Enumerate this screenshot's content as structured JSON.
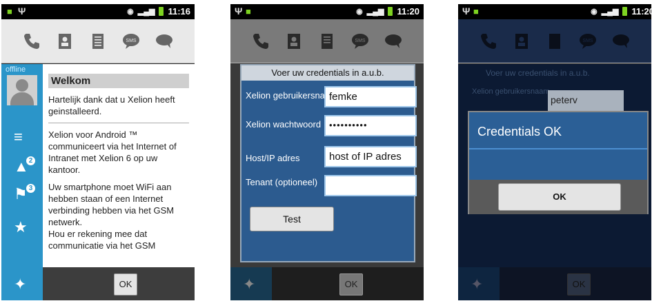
{
  "screens": [
    {
      "status": {
        "time": "11:16"
      },
      "sidebar": {
        "status_label": "offline",
        "alerts_badge": "2",
        "flags_badge": "3"
      },
      "content": {
        "title": "Welkom",
        "paragraph1": "Hartelijk dank dat u Xelion heeft geinstalleerd.",
        "paragraph2": "Xelion voor Android ™ communiceert via het Internet of Intranet met Xelion 6 op uw kantoor.",
        "paragraph3": "Uw smartphone moet WiFi aan hebben staan of een Internet verbinding hebben via het GSM netwerk.",
        "paragraph4": "Hou er rekening mee dat communicatie via het GSM"
      },
      "ok_label": "OK"
    },
    {
      "status": {
        "time": "11:20"
      },
      "dialog": {
        "title": "Voer uw credentials in a.u.b.",
        "username_label": "Xelion gebruikersnaam",
        "username_value": "femke",
        "password_label": "Xelion wachtwoord",
        "password_value": "••••••••••",
        "host_label": "Host/IP adres",
        "host_value": "host of IP adres",
        "tenant_label": "Tenant (optioneel)",
        "tenant_value": "",
        "test_label": "Test"
      },
      "ok_label": "OK"
    },
    {
      "status": {
        "time": "11:20"
      },
      "background_dialog": {
        "title": "Voer uw credentials in a.u.b.",
        "username_label": "Xelion gebruikersnaam",
        "username_value": "peterv"
      },
      "dialog": {
        "message": "Credentials OK",
        "ok_label": "OK"
      },
      "ok_label": "OK"
    }
  ],
  "toolbar_icons": [
    "phone-icon",
    "contacts-icon",
    "notes-icon",
    "sms-icon",
    "chat-icon"
  ],
  "toolbar_sms_text": "SMS",
  "colors": {
    "accent": "#2b95c9",
    "dialog_blue": "#2c5b8f",
    "battery": "#7ed321"
  }
}
